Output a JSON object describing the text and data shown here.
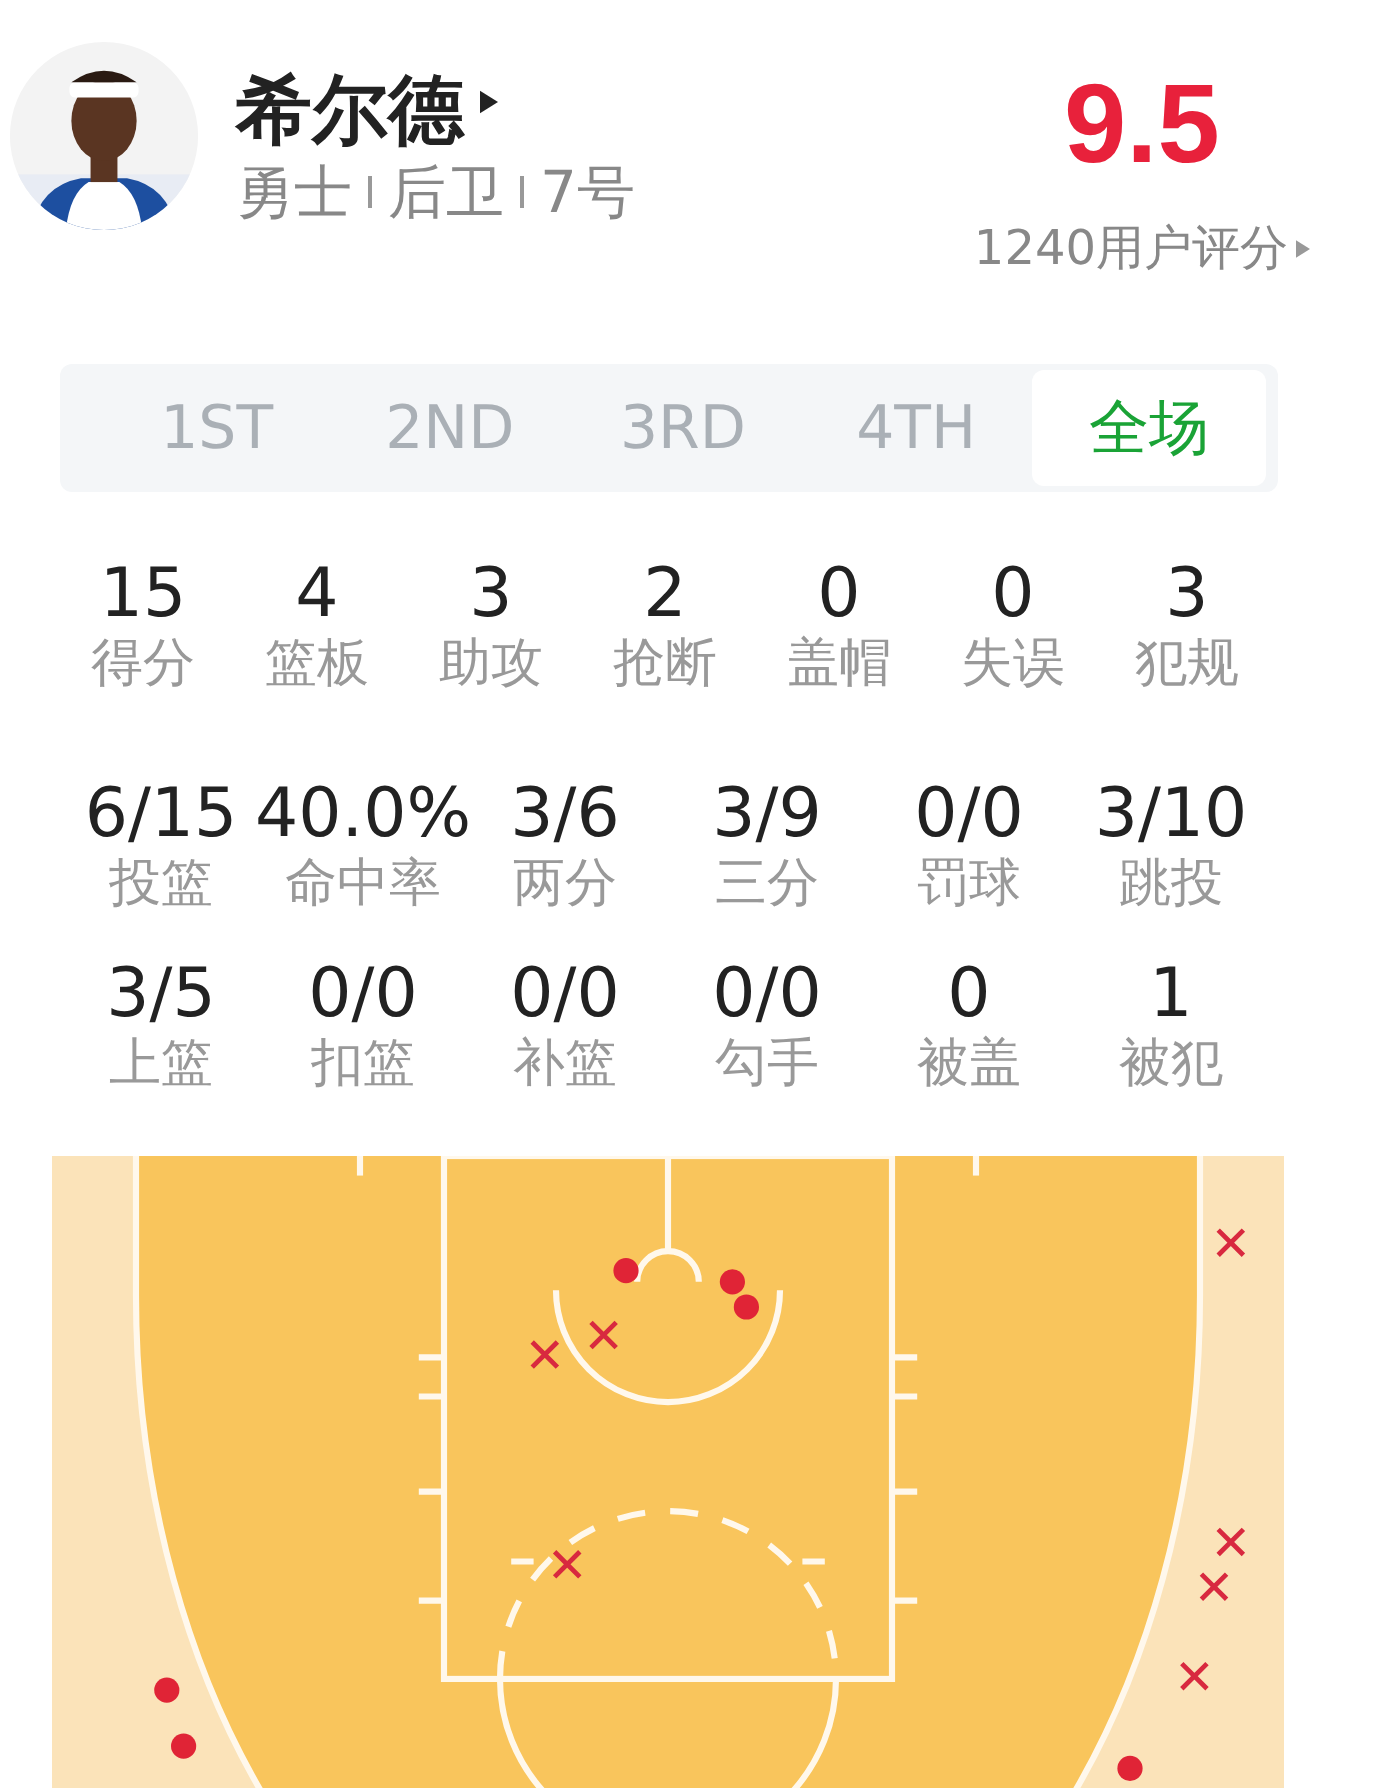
{
  "player": {
    "name": "希尔德",
    "team": "勇士",
    "position": "后卫",
    "number": "7号"
  },
  "rating": {
    "score": "9.5",
    "count": "1240用户评分"
  },
  "tabs": [
    {
      "label": "1ST",
      "selected": false
    },
    {
      "label": "2ND",
      "selected": false
    },
    {
      "label": "3RD",
      "selected": false
    },
    {
      "label": "4TH",
      "selected": false
    },
    {
      "label": "全场",
      "selected": true
    }
  ],
  "stat_rows": [
    [
      {
        "value": "15",
        "label": "得分"
      },
      {
        "value": "4",
        "label": "篮板"
      },
      {
        "value": "3",
        "label": "助攻"
      },
      {
        "value": "2",
        "label": "抢断"
      },
      {
        "value": "0",
        "label": "盖帽"
      },
      {
        "value": "0",
        "label": "失误"
      },
      {
        "value": "3",
        "label": "犯规"
      }
    ],
    [
      {
        "value": "6/15",
        "label": "投篮"
      },
      {
        "value": "40.0%",
        "label": "命中率"
      },
      {
        "value": "3/6",
        "label": "两分"
      },
      {
        "value": "3/9",
        "label": "三分"
      },
      {
        "value": "0/0",
        "label": "罚球"
      },
      {
        "value": "3/10",
        "label": "跳投"
      }
    ],
    [
      {
        "value": "3/5",
        "label": "上篮"
      },
      {
        "value": "0/0",
        "label": "扣篮"
      },
      {
        "value": "0/0",
        "label": "补篮"
      },
      {
        "value": "0/0",
        "label": "勾手"
      },
      {
        "value": "0",
        "label": "被盖"
      },
      {
        "value": "1",
        "label": "被犯"
      }
    ]
  ],
  "shot_chart": {
    "shots": [
      {
        "made": true
      },
      {
        "made": true
      },
      {
        "made": true
      },
      {
        "made": true
      },
      {
        "made": true
      },
      {
        "made": true
      },
      {
        "made": false
      },
      {
        "made": false
      },
      {
        "made": false
      },
      {
        "made": false
      },
      {
        "made": false
      },
      {
        "made": false
      },
      {
        "made": false
      }
    ]
  }
}
